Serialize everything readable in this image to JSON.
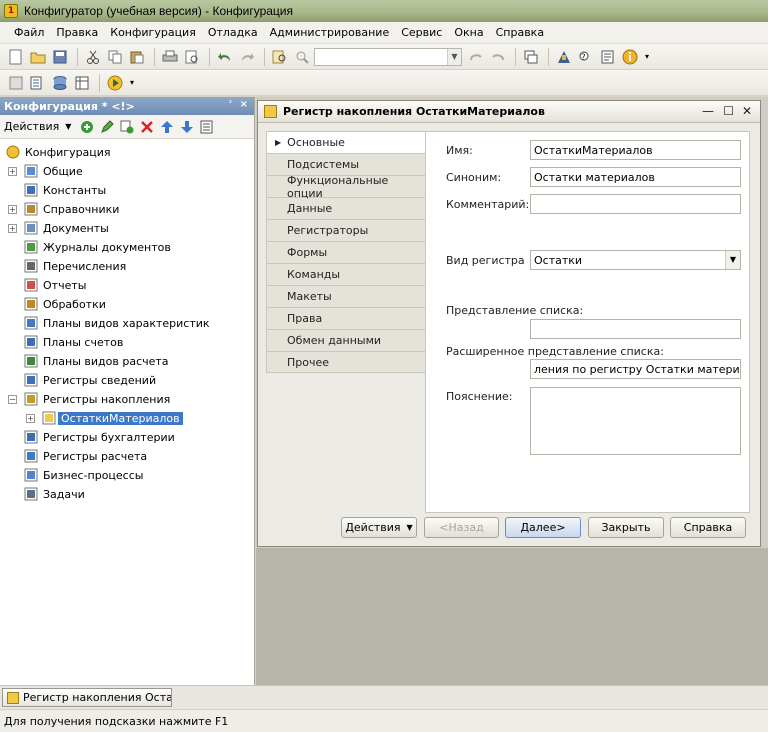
{
  "window": {
    "title": "Конфигуратор (учебная версия) - Конфигурация"
  },
  "menu": [
    "Файл",
    "Правка",
    "Конфигурация",
    "Отладка",
    "Администрирование",
    "Сервис",
    "Окна",
    "Справка"
  ],
  "left_panel": {
    "title": "Конфигурация * <!>",
    "actions_label": "Действия",
    "tree": [
      {
        "label": "Конфигурация",
        "icon": "config-icon",
        "expander": false,
        "indent": 0
      },
      {
        "label": "Общие",
        "icon": "common-icon",
        "expander": true,
        "indent": 1
      },
      {
        "label": "Константы",
        "icon": "constants-icon",
        "expander": false,
        "indent": 1
      },
      {
        "label": "Справочники",
        "icon": "catalogs-icon",
        "expander": true,
        "indent": 1
      },
      {
        "label": "Документы",
        "icon": "documents-icon",
        "expander": true,
        "indent": 1
      },
      {
        "label": "Журналы документов",
        "icon": "journals-icon",
        "expander": false,
        "indent": 1
      },
      {
        "label": "Перечисления",
        "icon": "enums-icon",
        "expander": false,
        "indent": 1
      },
      {
        "label": "Отчеты",
        "icon": "reports-icon",
        "expander": false,
        "indent": 1
      },
      {
        "label": "Обработки",
        "icon": "dataprocessors-icon",
        "expander": false,
        "indent": 1
      },
      {
        "label": "Планы видов характеристик",
        "icon": "chartofcharacteristics-icon",
        "expander": false,
        "indent": 1
      },
      {
        "label": "Планы счетов",
        "icon": "chartofaccounts-icon",
        "expander": false,
        "indent": 1
      },
      {
        "label": "Планы видов расчета",
        "icon": "chartofcalculation-icon",
        "expander": false,
        "indent": 1
      },
      {
        "label": "Регистры сведений",
        "icon": "inforegisters-icon",
        "expander": false,
        "indent": 1
      },
      {
        "label": "Регистры накопления",
        "icon": "accumregisters-icon",
        "expander": "open",
        "indent": 1
      },
      {
        "label": "ОстаткиМатериалов",
        "icon": "register-icon",
        "expander": true,
        "indent": 2,
        "selected": true
      },
      {
        "label": "Регистры бухгалтерии",
        "icon": "accountingregisters-icon",
        "expander": false,
        "indent": 1
      },
      {
        "label": "Регистры расчета",
        "icon": "calcregisters-icon",
        "expander": false,
        "indent": 1
      },
      {
        "label": "Бизнес-процессы",
        "icon": "businessprocess-icon",
        "expander": false,
        "indent": 1
      },
      {
        "label": "Задачи",
        "icon": "tasks-icon",
        "expander": false,
        "indent": 1
      }
    ]
  },
  "dialog": {
    "title": "Регистр накопления ОстаткиМатериалов",
    "tabs": [
      "Основные",
      "Подсистемы",
      "Функциональные опции",
      "Данные",
      "Регистраторы",
      "Формы",
      "Команды",
      "Макеты",
      "Права",
      "Обмен данными",
      "Прочее"
    ],
    "active_tab": "Основные",
    "fields": {
      "name_label": "Имя:",
      "name_value": "ОстаткиМатериалов",
      "synonym_label": "Синоним:",
      "synonym_value": "Остатки материалов",
      "comment_label": "Комментарий:",
      "comment_value": "",
      "register_kind_label": "Вид регистра",
      "register_kind_value": "Остатки",
      "list_presentation_label": "Представление списка:",
      "list_presentation_value": "",
      "ext_list_presentation_label": "Расширенное представление списка:",
      "ext_list_presentation_value": "ления по регистру Остатки материалов",
      "explanation_label": "Пояснение:",
      "explanation_value": ""
    },
    "buttons": {
      "actions": "Действия",
      "back": "<Назад",
      "next": "Далее>",
      "close": "Закрыть",
      "help": "Справка"
    }
  },
  "taskbar": {
    "window_tab": "Регистр накопления Остат..."
  },
  "status": {
    "text": "Для получения подсказки нажмите F1"
  }
}
